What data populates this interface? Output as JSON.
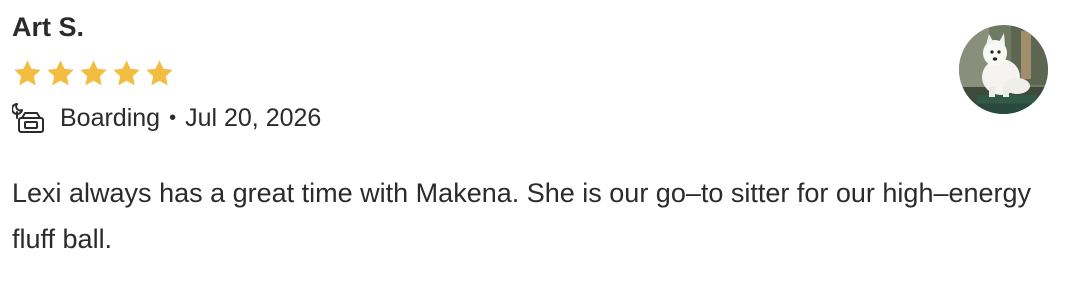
{
  "review": {
    "reviewer_name": "Art S.",
    "rating": 5,
    "rating_max": 5,
    "star_color": "#f3bd41",
    "service_icon": "boarding-icon",
    "service": "Boarding",
    "separator": "•",
    "date": "Jul 20, 2026",
    "text": "Lexi always has a great time with Makena. She is our go–to sitter for our high–energy fluff ball.",
    "avatar_icon": "dog-photo-avatar"
  }
}
